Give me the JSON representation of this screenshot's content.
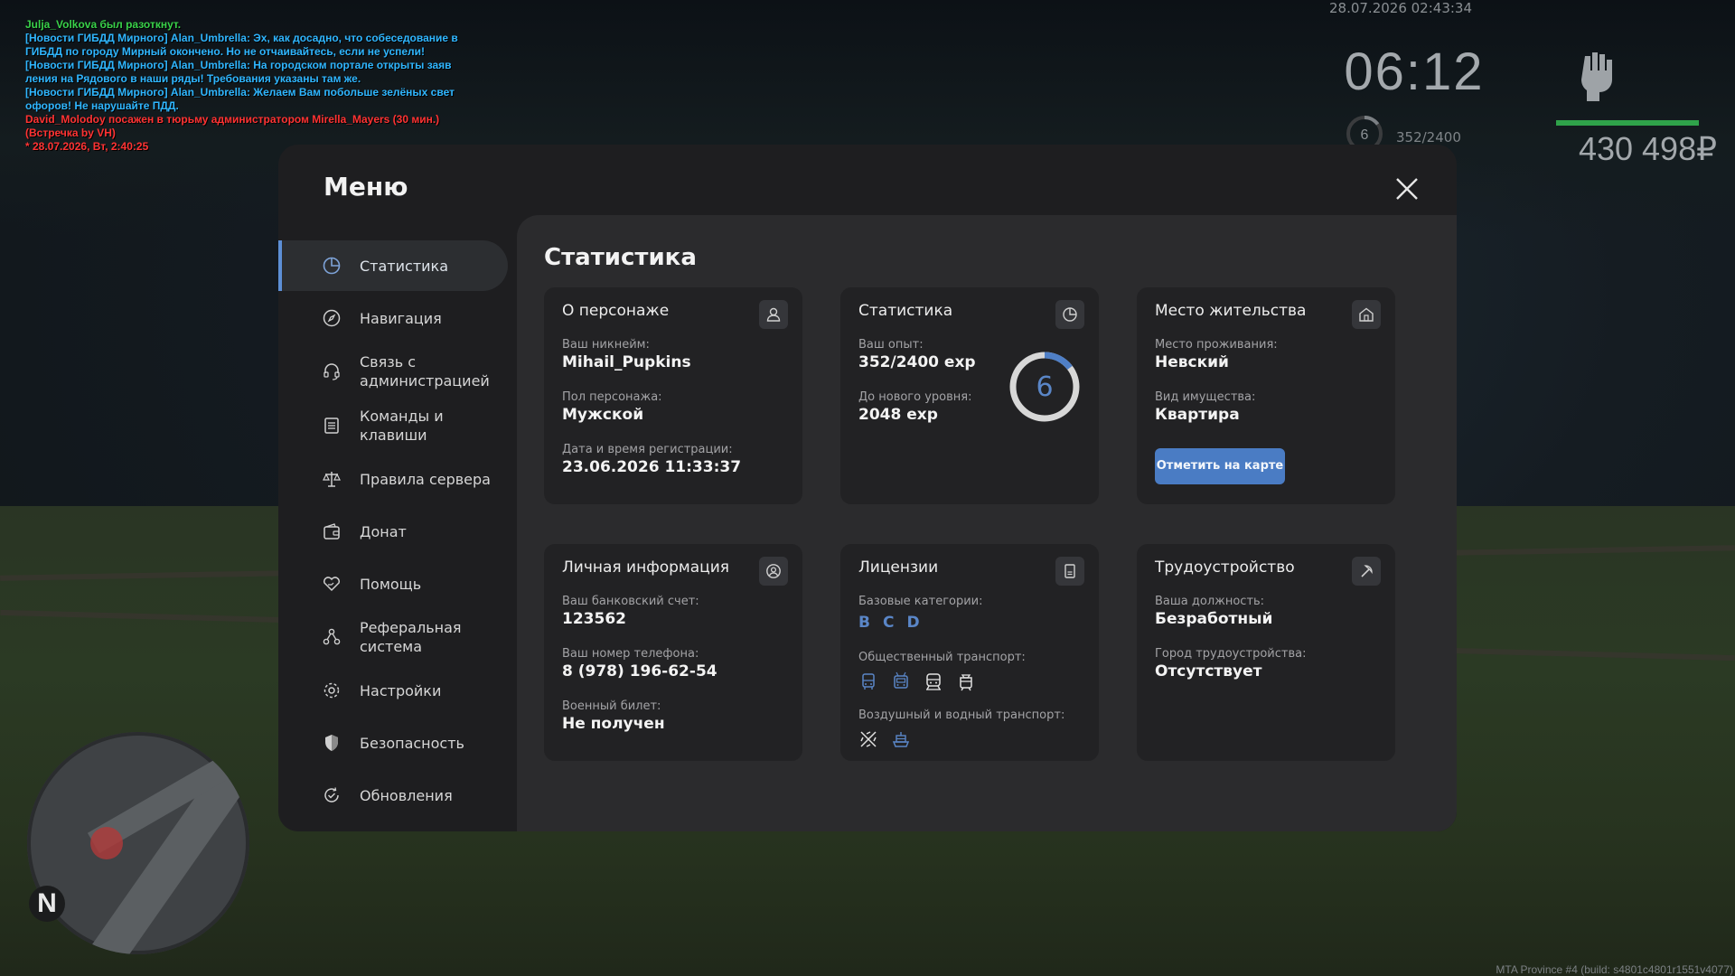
{
  "chat": [
    {
      "text": "Julja_Volkova был разоткнут.",
      "color": "#39d24a"
    },
    {
      "text": "[Новости ГИБДД Мирного] Alan_Umbrella: Эх, как досадно, что собеседование в",
      "color": "#2fb6ff"
    },
    {
      "text": " ГИБДД по городу Мирный окончено. Но не отчаивайтесь, если не успели!",
      "color": "#2fb6ff"
    },
    {
      "text": "[Новости ГИБДД Мирного] Alan_Umbrella: На городском портале открыты заяв",
      "color": "#2fb6ff"
    },
    {
      "text": "ления на Рядового в наши ряды! Требования указаны там же.",
      "color": "#2fb6ff"
    },
    {
      "text": "[Новости ГИБДД Мирного] Alan_Umbrella: Желаем Вам побольше зелёных свет",
      "color": "#2fb6ff"
    },
    {
      "text": "офоров! Не нарушайте ПДД.",
      "color": "#2fb6ff"
    },
    {
      "text": "David_Molodoy посажен в тюрьму администратором Mirella_Mayers (30 мин.)",
      "color": "#ff3333"
    },
    {
      "text": "(Встречка by VH)",
      "color": "#ff3333"
    },
    {
      "text": "* 28.07.2026, Вт, 2:40:25",
      "color": "#ff3333"
    }
  ],
  "hud": {
    "datetime": "28.07.2026 02:43:34",
    "clock": "06:12",
    "level": "6",
    "exp": "352/2400",
    "money": "430 498₽",
    "health_fraction": 1.0,
    "health_color": "#2fa24a",
    "fist_icon": "fist-icon"
  },
  "build": "MTA Province #4 (build: s4801c4801r1551v4077)",
  "minimap": {
    "north": "N"
  },
  "menu": {
    "title": "Меню",
    "nav": [
      {
        "label": "Статистика",
        "icon": "pie-chart-icon",
        "active": true
      },
      {
        "label": "Навигация",
        "icon": "compass-icon"
      },
      {
        "label": "Связь с администрацией",
        "icon": "headset-icon"
      },
      {
        "label": "Команды и клавиши",
        "icon": "document-icon"
      },
      {
        "label": "Правила сервера",
        "icon": "scales-icon"
      },
      {
        "label": "Донат",
        "icon": "wallet-icon"
      },
      {
        "label": "Помощь",
        "icon": "heart-hand-icon"
      },
      {
        "label": "Реферальная система",
        "icon": "network-icon"
      },
      {
        "label": "Настройки",
        "icon": "gear-icon"
      },
      {
        "label": "Безопасность",
        "icon": "shield-icon"
      },
      {
        "label": "Обновления",
        "icon": "refresh-check-icon"
      }
    ],
    "accent": "#5d8fd6"
  },
  "content": {
    "title": "Статистика",
    "character": {
      "title": "О персонаже",
      "nick_label": "Ваш никнейм:",
      "nick": "Mihail_Pupkins",
      "gender_label": "Пол персонажа:",
      "gender": "Мужской",
      "reg_label": "Дата и время регистрации:",
      "reg": "23.06.2026 11:33:37"
    },
    "stats": {
      "title": "Статистика",
      "exp_label": "Ваш опыт:",
      "exp": "352/2400 exp",
      "next_label": "До нового уровня:",
      "next": "2048 exp",
      "level": "6",
      "progress_fraction": 0.1467
    },
    "residence": {
      "title": "Место жительства",
      "place_label": "Место проживания:",
      "place": "Невский",
      "type_label": "Вид имущества:",
      "type": "Квартира",
      "button": "Отметить на карте"
    },
    "personal": {
      "title": "Личная информация",
      "bank_label": "Ваш банковский счет:",
      "bank": "123562",
      "phone_label": "Ваш номер телефона:",
      "phone": "8 (978) 196-62-54",
      "military_label": "Военный билет:",
      "military": "Не получен"
    },
    "licenses": {
      "title": "Лицензии",
      "base_label": "Базовые категории:",
      "base": [
        "B",
        "C",
        "D"
      ],
      "public_label": "Общественный транспорт:",
      "public_icons": [
        "bus-icon",
        "trolleybus-icon",
        "train-icon",
        "tram-icon"
      ],
      "air_label": "Воздушный и водный транспорт:",
      "air_icons": [
        "plane-icon",
        "ship-icon"
      ]
    },
    "job": {
      "title": "Трудоустройство",
      "position_label": "Ваша должность:",
      "position": "Безработный",
      "city_label": "Город трудоустройства:",
      "city": "Отсутствует"
    }
  }
}
